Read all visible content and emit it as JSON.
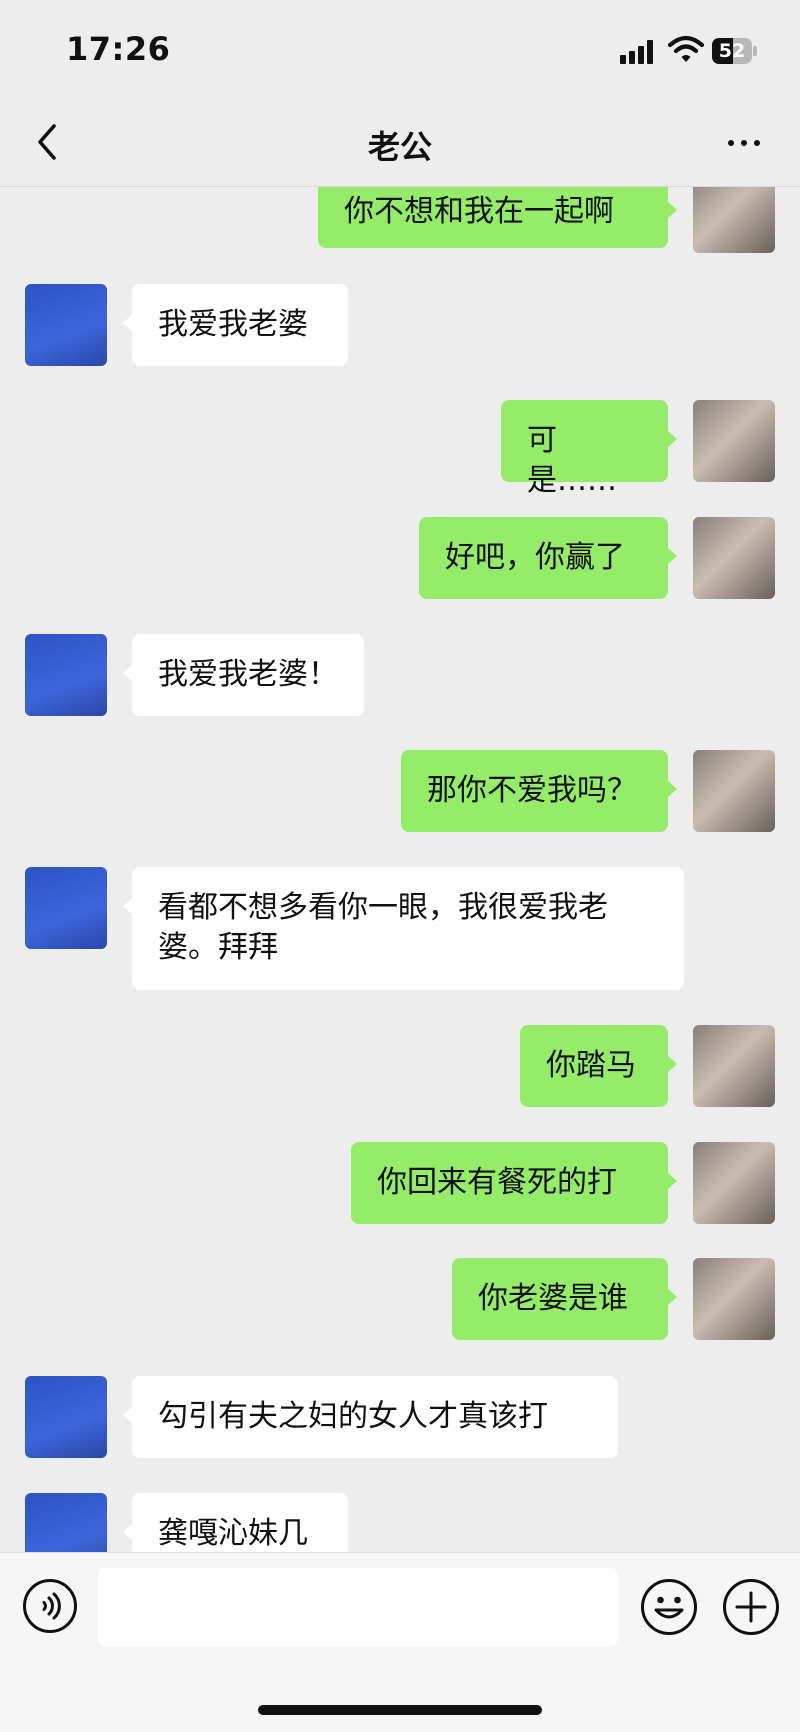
{
  "status_bar": {
    "time": "17:26",
    "battery": "52",
    "battery_level_percent": 52
  },
  "nav": {
    "title": "老公",
    "back_icon": "chevron-left-icon",
    "more_icon": "more-dots-icon"
  },
  "messages": [
    {
      "side": "sent",
      "text": "你不想和我在一起啊"
    },
    {
      "side": "received",
      "text": "我爱我老婆"
    },
    {
      "side": "sent",
      "text": "可是……"
    },
    {
      "side": "sent",
      "text": "好吧，你赢了"
    },
    {
      "side": "received",
      "text": "我爱我老婆！"
    },
    {
      "side": "sent",
      "text": "那你不爱我吗？"
    },
    {
      "side": "received",
      "text_line1": "看都不想多看你一眼，我很爱我老",
      "text_line2": "婆。拜拜"
    },
    {
      "side": "sent",
      "text": "你踏马"
    },
    {
      "side": "sent",
      "text": "你回来有餐死的打"
    },
    {
      "side": "sent",
      "text": "你老婆是谁"
    },
    {
      "side": "received",
      "text": "勾引有夫之妇的女人才真该打"
    },
    {
      "side": "received",
      "text": "龚嘎沁妹几"
    }
  ],
  "input_bar": {
    "placeholder": "",
    "voice_icon": "voice-icon",
    "emoji_icon": "emoji-icon",
    "more_icon": "plus-icon"
  },
  "colors": {
    "sent_bubble": "#95ec69",
    "received_bubble": "#ffffff",
    "background": "#ededed"
  }
}
